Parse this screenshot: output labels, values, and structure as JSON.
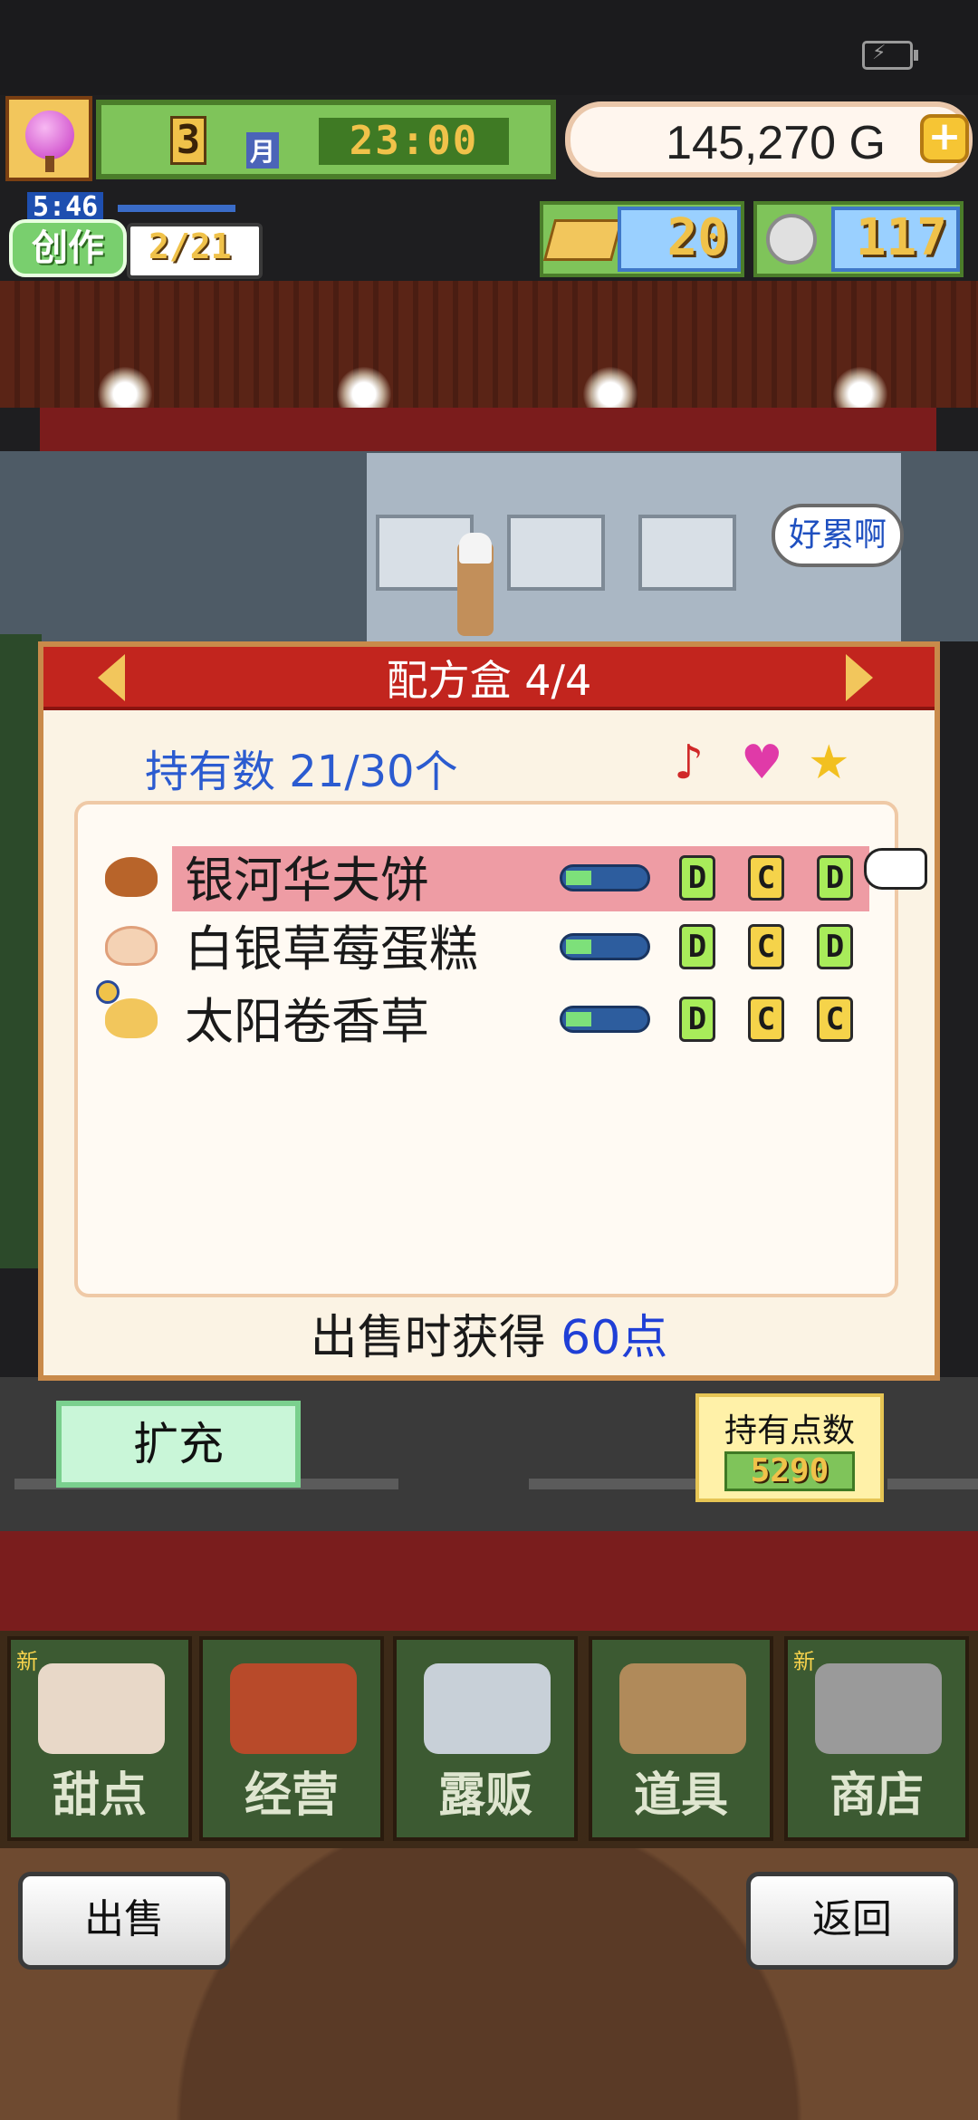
{
  "hud": {
    "month_number": "3",
    "month_label": "月",
    "time": "23:00",
    "gold": "145,270 G",
    "gold_plus": "+"
  },
  "create": {
    "timer": "5:46",
    "label": "创作",
    "progress": "2/21"
  },
  "resources": {
    "gold_bars": "20",
    "coins": "117"
  },
  "speech_bubble": "好累啊",
  "dialog": {
    "title": "配方盒 4/4",
    "hold_count": "持有数 21/30个",
    "header_icons": [
      "music-note-icon",
      "heart-icon",
      "star-icon"
    ],
    "recipes": [
      {
        "name": "银河华夫饼",
        "grades": [
          "D",
          "C",
          "D"
        ],
        "selected": true
      },
      {
        "name": "白银草莓蛋糕",
        "grades": [
          "D",
          "C",
          "D"
        ],
        "selected": false
      },
      {
        "name": "太阳卷香草",
        "grades": [
          "D",
          "C",
          "C"
        ],
        "selected": false
      }
    ],
    "sell_label": "出售时获得 ",
    "sell_points": "60点"
  },
  "expand_button": "扩充",
  "points": {
    "label": "持有点数",
    "value": "5290"
  },
  "menu": [
    {
      "label": "甜点",
      "new": "新"
    },
    {
      "label": "经营",
      "new": ""
    },
    {
      "label": "露贩",
      "new": ""
    },
    {
      "label": "道具",
      "new": ""
    },
    {
      "label": "商店",
      "new": "新"
    }
  ],
  "bottom": {
    "sell": "出售",
    "back": "返回"
  },
  "colors": {
    "header_red": "#c2251e",
    "selected_row": "#ee9ca4",
    "points_blue": "#1f3fd6",
    "grade_D": "#a8ec5a",
    "grade_C": "#f5d34a"
  }
}
